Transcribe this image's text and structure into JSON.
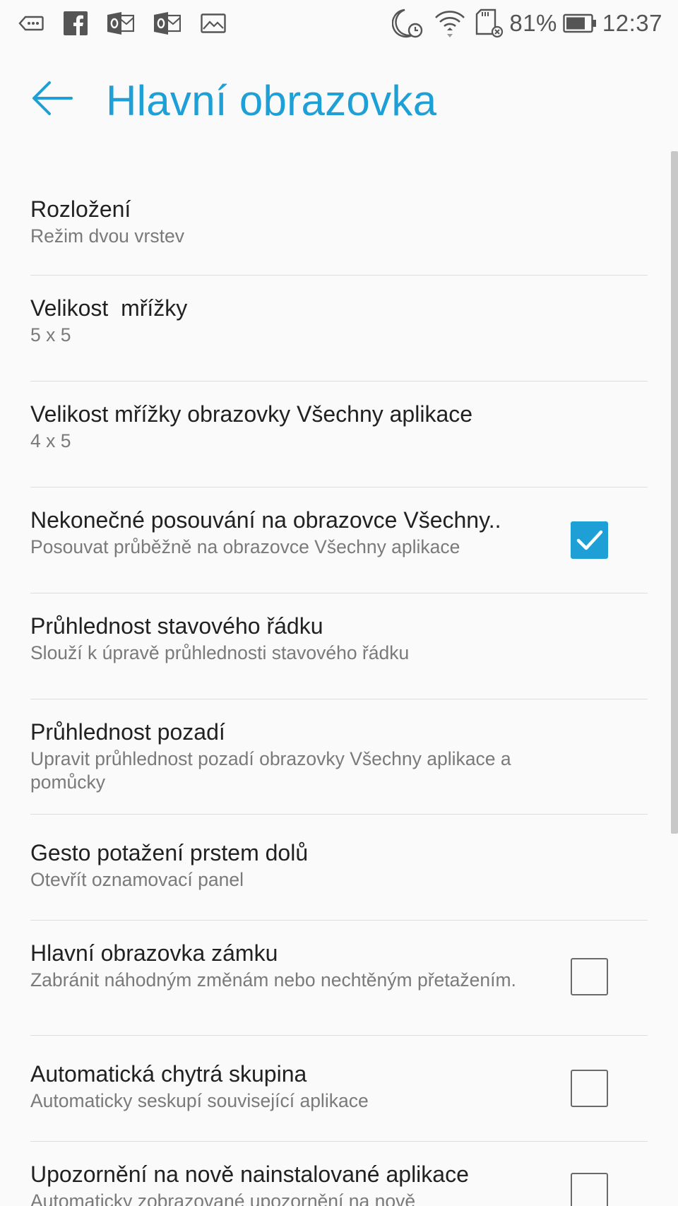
{
  "status_bar": {
    "battery_percent": "81%",
    "time": "12:37",
    "left_icons": [
      "voicemail-icon",
      "facebook-icon",
      "outlook-icon",
      "outlook-icon",
      "gallery-icon"
    ],
    "right_icons": [
      "night-alarm-icon",
      "wifi-icon",
      "sd-card-icon",
      "battery-icon"
    ]
  },
  "header": {
    "title": "Hlavní obrazovka",
    "back_icon": "back-arrow-icon"
  },
  "colors": {
    "accent": "#1ea0d6",
    "title_text": "#212121",
    "subtitle_text": "#7a7a7a",
    "divider": "#dcdcdc",
    "background": "#fafafa"
  },
  "settings": [
    {
      "title": "Rozložení",
      "subtitle": "Režim dvou vrstev"
    },
    {
      "title": "Velikost  mřížky",
      "subtitle": "5 x 5"
    },
    {
      "title": "Velikost mřížky obrazovky Všechny aplikace",
      "subtitle": "4 x 5"
    },
    {
      "title": "Nekonečné posouvání na obrazovce Všechny..",
      "subtitle": "Posouvat průběžně na obrazovce Všechny aplikace",
      "checkbox": true,
      "checked": true
    },
    {
      "title": "Průhlednost stavového řádku",
      "subtitle": "Slouží k úpravě průhlednosti stavového řádku"
    },
    {
      "title": "Průhlednost pozadí",
      "subtitle": "Upravit průhlednost pozadí obrazovky Všechny aplikace a pomůcky"
    },
    {
      "title": "Gesto potažení prstem dolů",
      "subtitle": "Otevřít oznamovací panel"
    },
    {
      "title": "Hlavní obrazovka zámku",
      "subtitle": "Zabránit náhodným změnám nebo nechtěným přetažením.",
      "checkbox": true,
      "checked": false
    },
    {
      "title": "Automatická chytrá skupina",
      "subtitle": "Automaticky seskupí související aplikace",
      "checkbox": true,
      "checked": false
    },
    {
      "title": "Upozornění na nově nainstalované aplikace",
      "subtitle": "Automaticky zobrazované upozornění na nově",
      "checkbox": true,
      "checked": false
    }
  ]
}
